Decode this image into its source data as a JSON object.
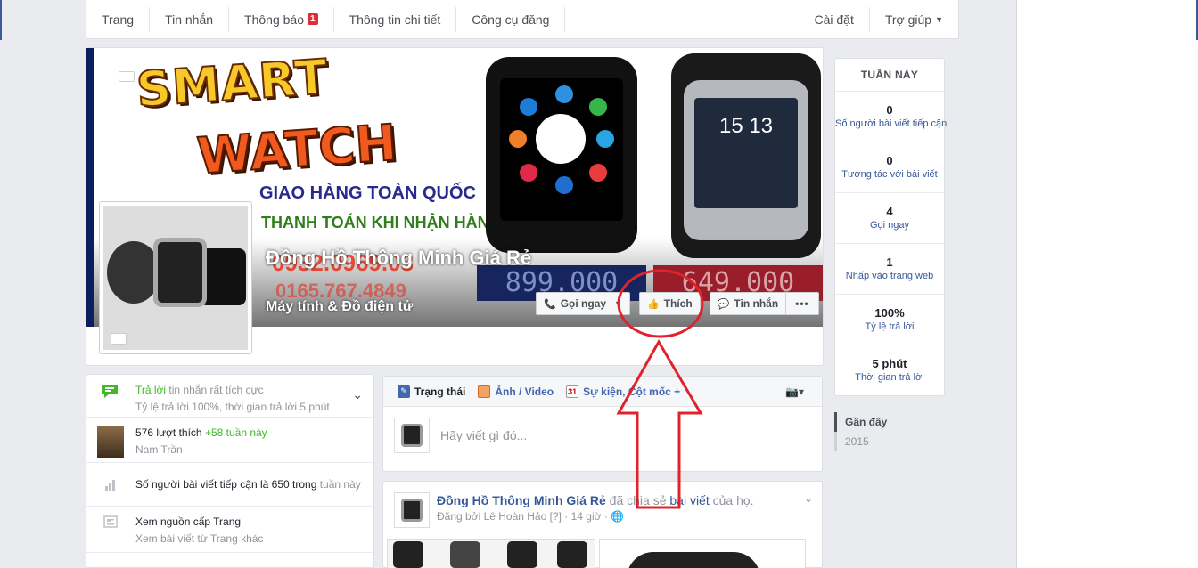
{
  "nav": {
    "items": [
      {
        "label": "Trang"
      },
      {
        "label": "Tin nhắn"
      },
      {
        "label": "Thông báo",
        "badge": "1"
      },
      {
        "label": "Thông tin chi tiết"
      },
      {
        "label": "Công cụ đăng"
      }
    ],
    "settings": "Cài đặt",
    "help": "Trợ giúp"
  },
  "cover": {
    "brand_line1": "SMART",
    "brand_line2": "WATCH",
    "promo1": "GIAO HÀNG TOÀN QUỐC",
    "promo2": "THANH TOÁN KHI NHẬN HÀNG",
    "phone1": "0932.0969.03",
    "phone2": "0165.767.4849",
    "price1": "899.000",
    "price2": "649.000",
    "watch_time": "15 13"
  },
  "page": {
    "name": "Đồng Hồ Thông Minh Giá Rẻ",
    "category": "Máy tính & Đồ điện tử"
  },
  "cover_buttons": {
    "call": "Gọi ngay",
    "like": "Thích",
    "message": "Tin nhắn",
    "more": "•••"
  },
  "left": {
    "responsiveness": {
      "title_green": "Trả lời",
      "title_rest": " tin nhắn rất tích cực",
      "sub": "Tỷ lệ trả lời 100%, thời gian trả lời 5 phút"
    },
    "likes": {
      "count": "576 lượt thích",
      "delta": " +58 tuần này",
      "person": "Nam Trần"
    },
    "reach": {
      "text": "Số người bài viết tiếp cận là 650 trong",
      "suffix": " tuần này"
    },
    "feed": {
      "title": "Xem nguồn cấp Trang",
      "sub": "Xem bài viết từ Trang khác"
    }
  },
  "composer": {
    "tab_status": "Trạng thái",
    "tab_photo": "Ảnh / Video",
    "tab_event": "Sự kiện, Cột mốc +",
    "placeholder": "Hãy viết gì đó..."
  },
  "post": {
    "page_name": "Đồng Hồ Thông Minh Giá Rẻ",
    "shared": " đã chia sẻ ",
    "link": "bài viết",
    "tail": " của họ.",
    "meta": "Đăng bởi Lê Hoàn Hảo [?] · 14 giờ · "
  },
  "stats": {
    "title": "TUẦN NÀY",
    "items": [
      {
        "num": "0",
        "label": "Số người bài viết tiếp cận"
      },
      {
        "num": "0",
        "label": "Tương tác với bài viết"
      },
      {
        "num": "4",
        "label": "Gọi ngay"
      },
      {
        "num": "1",
        "label": "Nhấp vào trang web"
      },
      {
        "num": "100%",
        "label": "Tỷ lệ trả lời"
      },
      {
        "num": "5 phút",
        "label": "Thời gian trả lời"
      }
    ]
  },
  "timeline": {
    "recent": "Gần đây",
    "year": "2015"
  },
  "colors": {
    "facebook_blue": "#3b5998",
    "link_blue": "#365899",
    "green": "#42b72a",
    "annotation_red": "#e0232b"
  }
}
